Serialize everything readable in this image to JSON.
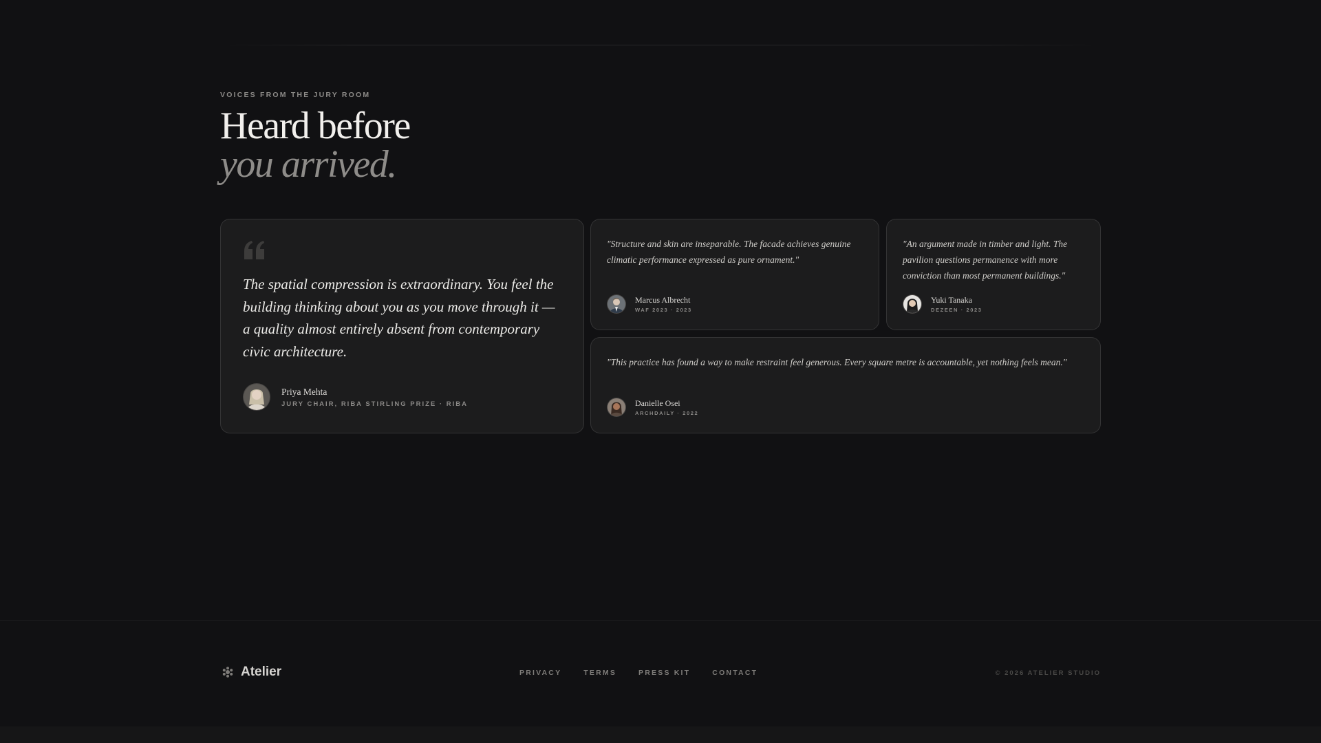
{
  "header": {
    "eyebrow": "VOICES FROM THE JURY ROOM",
    "headline_line1": "Heard before",
    "headline_line2": "you arrived."
  },
  "testimonials": [
    {
      "quote": "The spatial compression is extraordinary. You feel the building thinking about you as you move through it — a quality almost entirely absent from contemporary civic architecture.",
      "name": "Priya Mehta",
      "role": "JURY CHAIR, RIBA STIRLING PRIZE · RIBA"
    },
    {
      "quote": "\"Structure and skin are inseparable. The facade achieves genuine climatic performance expressed as pure ornament.\"",
      "name": "Marcus Albrecht",
      "role": "WAF 2023 · 2023"
    },
    {
      "quote": "\"An argument made in timber and light. The pavilion questions permanence with more conviction than most permanent buildings.\"",
      "name": "Yuki Tanaka",
      "role": "DEZEEN · 2023"
    },
    {
      "quote": "\"This practice has found a way to make restraint feel generous. Every square metre is accountable, yet nothing feels mean.\"",
      "name": "Danielle Osei",
      "role": "ARCHDAILY · 2022"
    }
  ],
  "footer": {
    "brand": "Atelier",
    "links": [
      "PRIVACY",
      "TERMS",
      "PRESS KIT",
      "CONTACT"
    ],
    "copyright": "© 2026 ATELIER STUDIO"
  }
}
